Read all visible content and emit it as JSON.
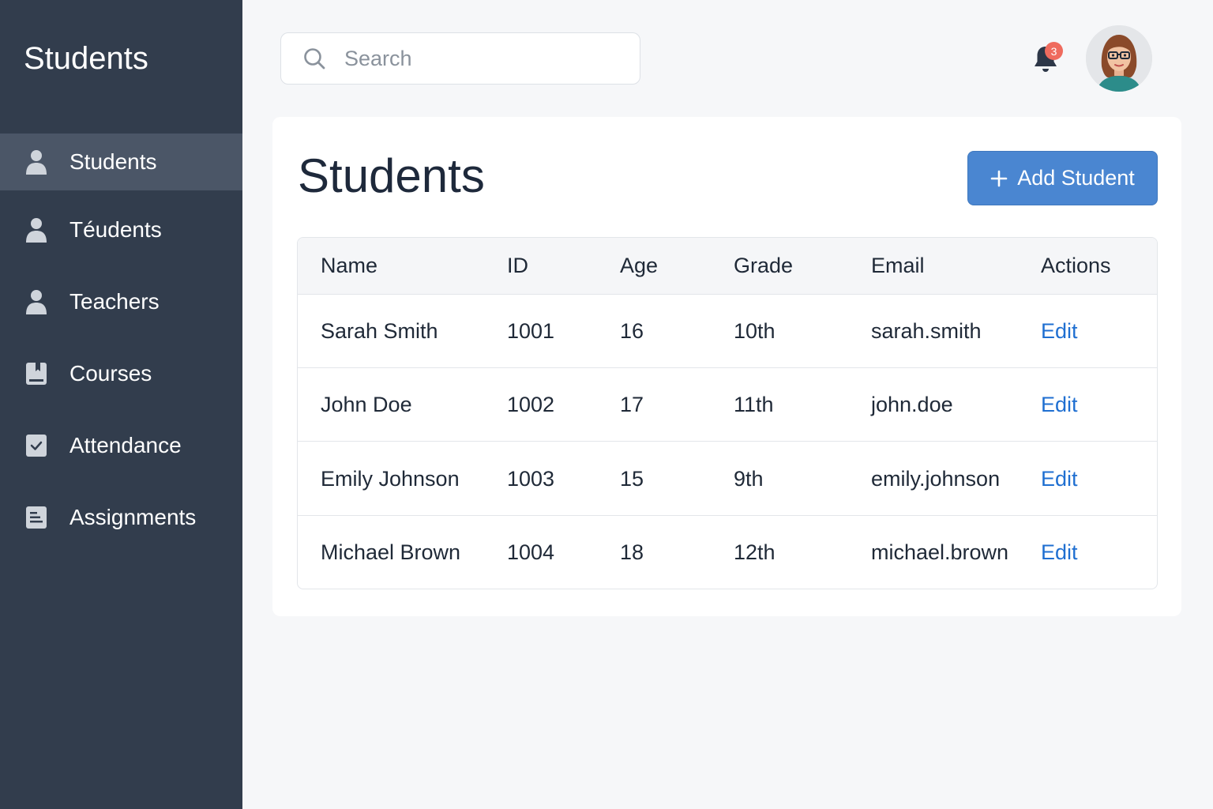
{
  "sidebar": {
    "brand": "Students",
    "items": [
      {
        "label": "Students",
        "icon": "user-icon",
        "active": true
      },
      {
        "label": "Téudents",
        "icon": "user-icon",
        "active": false
      },
      {
        "label": "Teachers",
        "icon": "user-icon",
        "active": false
      },
      {
        "label": "Courses",
        "icon": "book-icon",
        "active": false
      },
      {
        "label": "Attendance",
        "icon": "checkbox-icon",
        "active": false
      },
      {
        "label": "Assignments",
        "icon": "document-icon",
        "active": false
      }
    ]
  },
  "header": {
    "search": {
      "placeholder": "Search",
      "value": ""
    },
    "notifications": {
      "count": "3",
      "icon": "bell-icon"
    },
    "avatar": {
      "icon": "avatar-woman-glasses"
    }
  },
  "main": {
    "title": "Students",
    "add_button": {
      "label": "Add Student",
      "icon": "plus-icon"
    },
    "table": {
      "columns": [
        "Name",
        "ID",
        "Age",
        "Grade",
        "Email",
        "Actions"
      ],
      "rows": [
        {
          "name": "Sarah Smith",
          "id": "1001",
          "age": "16",
          "grade": "10th",
          "email": "sarah.smith",
          "action": "Edit"
        },
        {
          "name": "John Doe",
          "id": "1002",
          "age": "17",
          "grade": "11th",
          "email": "john.doe",
          "action": "Edit"
        },
        {
          "name": "Emily Johnson",
          "id": "1003",
          "age": "15",
          "grade": "9th",
          "email": "emily.johnson",
          "action": "Edit"
        },
        {
          "name": "Michael Brown",
          "id": "1004",
          "age": "18",
          "grade": "12th",
          "email": "michael.brown",
          "action": "Edit"
        }
      ]
    }
  },
  "colors": {
    "sidebar_bg": "#323d4d",
    "sidebar_active": "#4b5667",
    "accent": "#4a86d1",
    "link": "#1f6fd1",
    "badge": "#ef6b5e"
  }
}
